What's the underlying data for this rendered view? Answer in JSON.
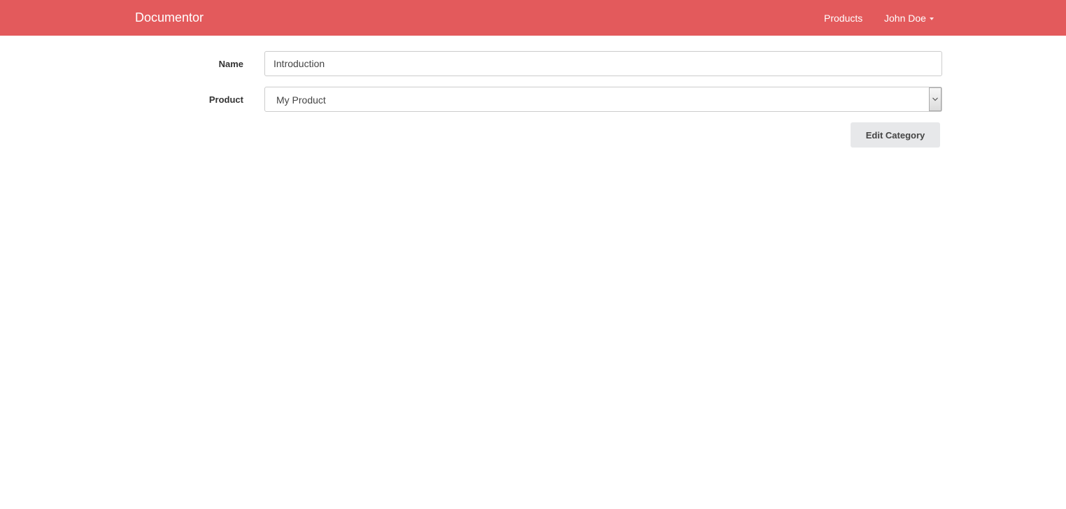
{
  "navbar": {
    "brand": "Documentor",
    "links": {
      "products": "Products",
      "user": "John Doe"
    },
    "color": "#e35a5c"
  },
  "form": {
    "name_label": "Name",
    "name_value": "Introduction",
    "product_label": "Product",
    "product_selected": "My Product",
    "submit_label": "Edit Category"
  },
  "icons": {
    "user_menu": "caret-down-icon",
    "select": "chevron-down-icon"
  }
}
